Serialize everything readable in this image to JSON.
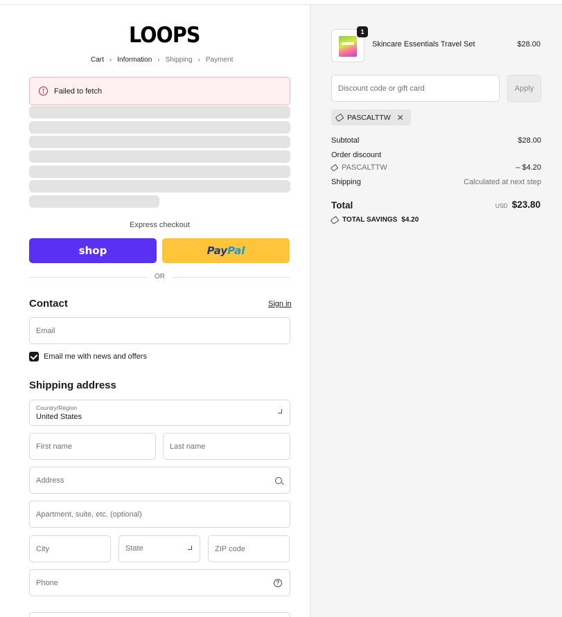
{
  "brand": {
    "logo": "LOOPS"
  },
  "breadcrumb": {
    "cart": "Cart",
    "information": "Information",
    "shipping": "Shipping",
    "payment": "Payment"
  },
  "error": {
    "message": "Failed to fetch"
  },
  "express": {
    "label": "Express checkout",
    "shop_label": "shop",
    "paypal_pay": "Pay",
    "paypal_pal": "Pal",
    "or_label": "OR"
  },
  "contact": {
    "title": "Contact",
    "sign_in": "Sign in",
    "email_placeholder": "Email",
    "news_label": "Email me with news and offers",
    "news_checked": true
  },
  "shipping_address": {
    "title": "Shipping address",
    "country_label": "Country/Region",
    "country_value": "United States",
    "first_name": "First name",
    "last_name": "Last name",
    "address": "Address",
    "apartment": "Apartment, suite, etc. (optional)",
    "city": "City",
    "state": "State",
    "zip": "ZIP code",
    "phone": "Phone"
  },
  "order": {
    "item": {
      "name": "Skincare Essentials Travel Set",
      "price": "$28.00",
      "quantity": "1"
    },
    "discount_placeholder": "Discount code or gift card",
    "apply_label": "Apply",
    "code": "PASCALTTW",
    "subtotal_label": "Subtotal",
    "subtotal_value": "$28.00",
    "order_discount_label": "Order discount",
    "discount_code": "PASCALTTW",
    "discount_value": "– $4.20",
    "shipping_label": "Shipping",
    "shipping_value": "Calculated at next step",
    "total_label": "Total",
    "total_currency": "USD",
    "total_value": "$23.80",
    "savings_label": "TOTAL SAVINGS",
    "savings_value": "$4.20"
  },
  "colors": {
    "shop_pay": "#5a31f4",
    "paypal": "#ffc439",
    "error_bg": "#fff1f1",
    "error_icon": "#c5221f"
  }
}
